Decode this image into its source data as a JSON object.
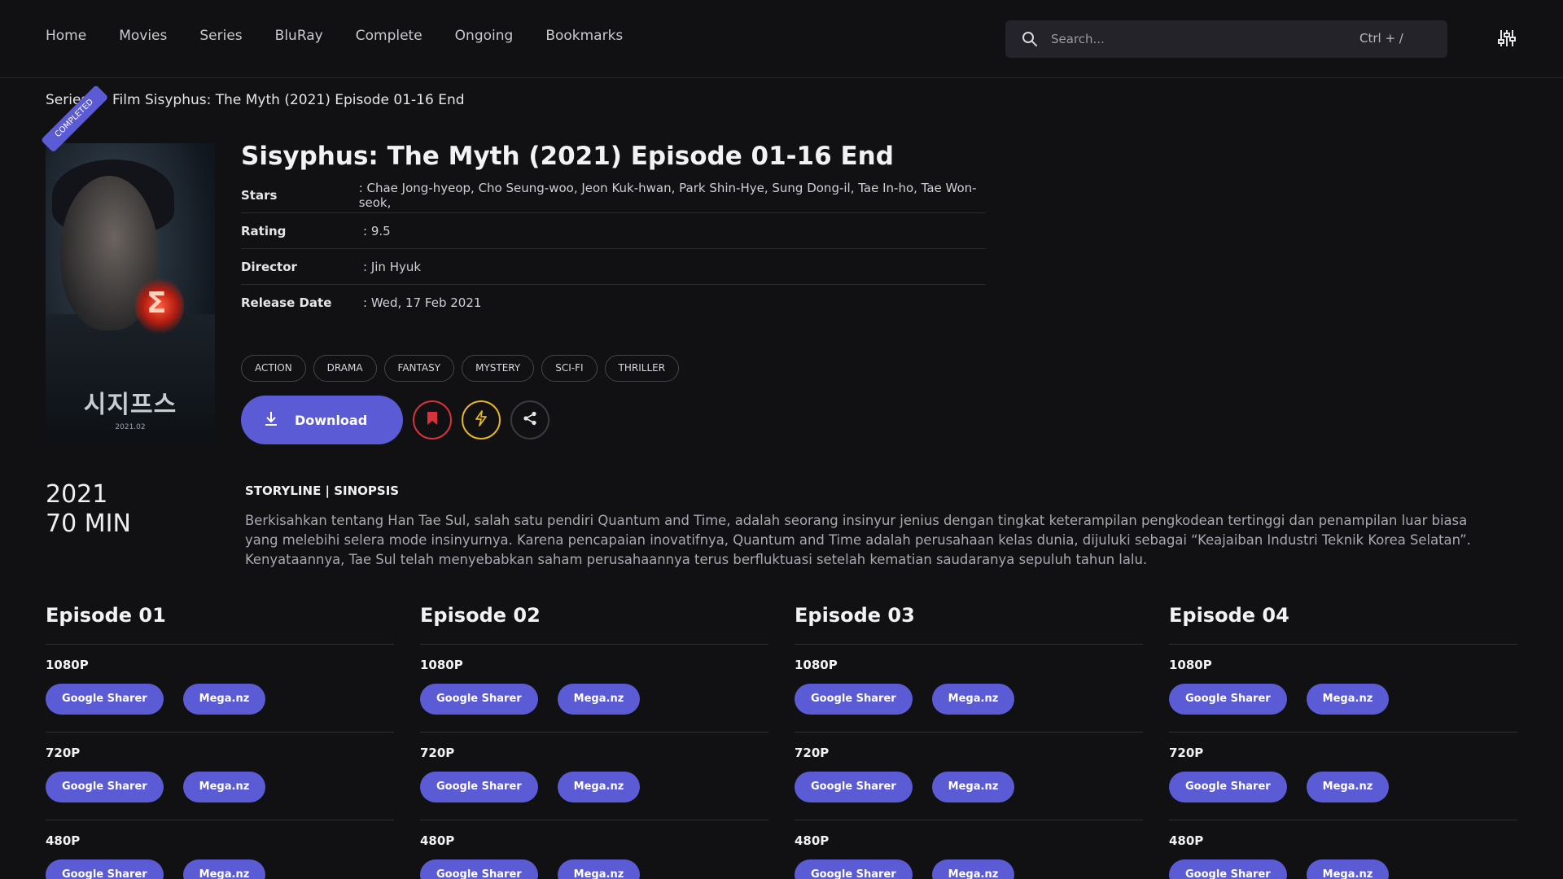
{
  "nav": {
    "items": [
      "Home",
      "Movies",
      "Series",
      "BluRay",
      "Complete",
      "Ongoing",
      "Bookmarks"
    ]
  },
  "search": {
    "placeholder": "Search...",
    "shortcut": "Ctrl + /"
  },
  "breadcrumb": {
    "parent": "Series",
    "separator": "/",
    "current": "Film Sisyphus: The Myth (2021) Episode 01-16 End"
  },
  "poster": {
    "badge": "COMPLETED",
    "title_text": "시지프스",
    "date_text": "2021.02"
  },
  "title": "Sisyphus: The Myth (2021) Episode 01-16 End",
  "info": [
    {
      "label": "Stars",
      "value": ": Chae Jong-hyeop, Cho Seung-woo, Jeon Kuk-hwan, Park Shin-Hye, Sung Dong-il, Tae In-ho, Tae Won-seok,"
    },
    {
      "label": "Rating",
      "value": ": 9.5"
    },
    {
      "label": "Director",
      "value": ": Jin Hyuk"
    },
    {
      "label": "Release Date",
      "value": ": Wed, 17 Feb 2021"
    }
  ],
  "genres": [
    "ACTION",
    "DRAMA",
    "FANTASY",
    "MYSTERY",
    "SCI-FI",
    "THRILLER"
  ],
  "actions": {
    "download_label": "Download"
  },
  "meta": {
    "year": "2021",
    "duration": "70 MIN"
  },
  "storyline": {
    "heading": "STORYLINE | SINOPSIS",
    "text": "Berkisahkan tentang Han Tae Sul, salah satu pendiri Quantum and Time, adalah seorang insinyur jenius dengan tingkat keterampilan pengkodean tertinggi dan penampilan luar biasa yang melebihi selera mode insinyurnya. Karena pencapaian inovatifnya, Quantum and Time adalah perusahaan kelas dunia, dijuluki sebagai “Keajaiban Industri Teknik Korea Selatan”. Kenyataannya, Tae Sul telah menyebabkan saham perusahaannya terus berfluktuasi setelah kematian saudaranya sepuluh tahun lalu."
  },
  "episodes": [
    {
      "title": "Episode 01",
      "qualities": [
        {
          "label": "1080P",
          "links": [
            "Google Sharer",
            "Mega.nz"
          ]
        },
        {
          "label": "720P",
          "links": [
            "Google Sharer",
            "Mega.nz"
          ]
        },
        {
          "label": "480P",
          "links": [
            "Google Sharer",
            "Mega.nz"
          ]
        }
      ]
    },
    {
      "title": "Episode 02",
      "qualities": [
        {
          "label": "1080P",
          "links": [
            "Google Sharer",
            "Mega.nz"
          ]
        },
        {
          "label": "720P",
          "links": [
            "Google Sharer",
            "Mega.nz"
          ]
        },
        {
          "label": "480P",
          "links": [
            "Google Sharer",
            "Mega.nz"
          ]
        }
      ]
    },
    {
      "title": "Episode 03",
      "qualities": [
        {
          "label": "1080P",
          "links": [
            "Google Sharer",
            "Mega.nz"
          ]
        },
        {
          "label": "720P",
          "links": [
            "Google Sharer",
            "Mega.nz"
          ]
        },
        {
          "label": "480P",
          "links": [
            "Google Sharer",
            "Mega.nz"
          ]
        }
      ]
    },
    {
      "title": "Episode 04",
      "qualities": [
        {
          "label": "1080P",
          "links": [
            "Google Sharer",
            "Mega.nz"
          ]
        },
        {
          "label": "720P",
          "links": [
            "Google Sharer",
            "Mega.nz"
          ]
        },
        {
          "label": "480P",
          "links": [
            "Google Sharer",
            "Mega.nz"
          ]
        }
      ]
    }
  ],
  "colors": {
    "accent": "#5b5bd6",
    "background": "#111114",
    "bookmark": "#d6333a",
    "bolt": "#e3b622"
  },
  "icons": {
    "search": "search-icon",
    "filter": "sliders-icon",
    "download": "download-icon",
    "bookmark": "bookmark-icon",
    "bolt": "bolt-icon",
    "share": "share-icon"
  }
}
